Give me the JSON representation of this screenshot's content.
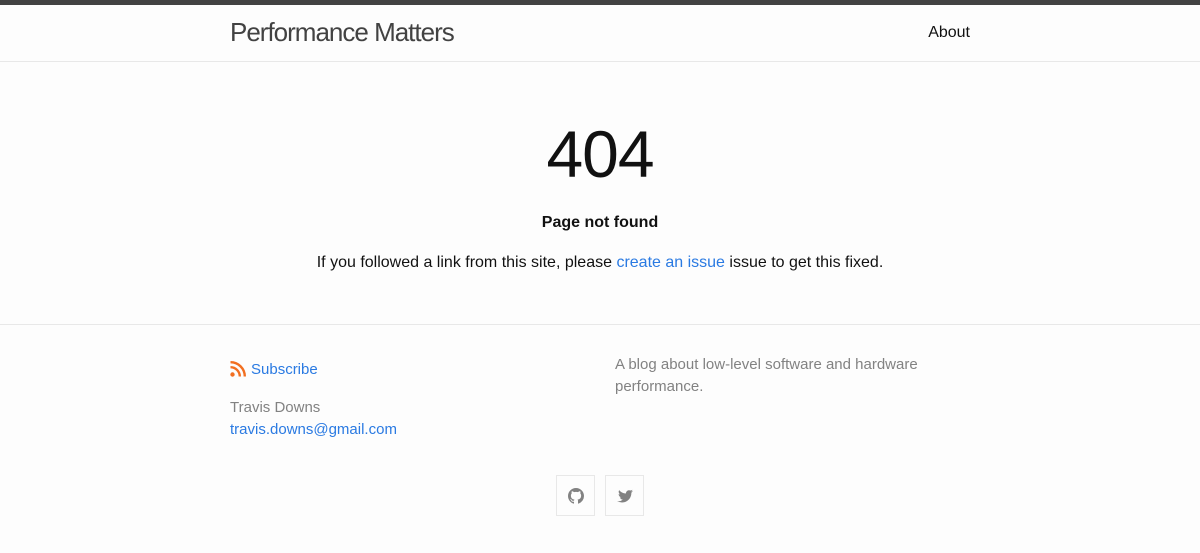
{
  "header": {
    "site_title": "Performance Matters",
    "nav": {
      "about": "About"
    }
  },
  "main": {
    "code": "404",
    "subtitle": "Page not found",
    "message_before": "If you followed a link from this site, please ",
    "message_link": "create an issue",
    "message_after": " issue to get this fixed."
  },
  "footer": {
    "subscribe": "Subscribe",
    "author_name": "Travis Downs",
    "email": "travis.downs@gmail.com",
    "description": "A blog about low-level software and hardware performance.",
    "social": [
      {
        "icon": "github-icon"
      },
      {
        "icon": "twitter-icon"
      }
    ]
  },
  "colors": {
    "link": "#2a7ae2",
    "rss": "#f26f21",
    "muted": "#828282",
    "top_bar": "#424242"
  }
}
